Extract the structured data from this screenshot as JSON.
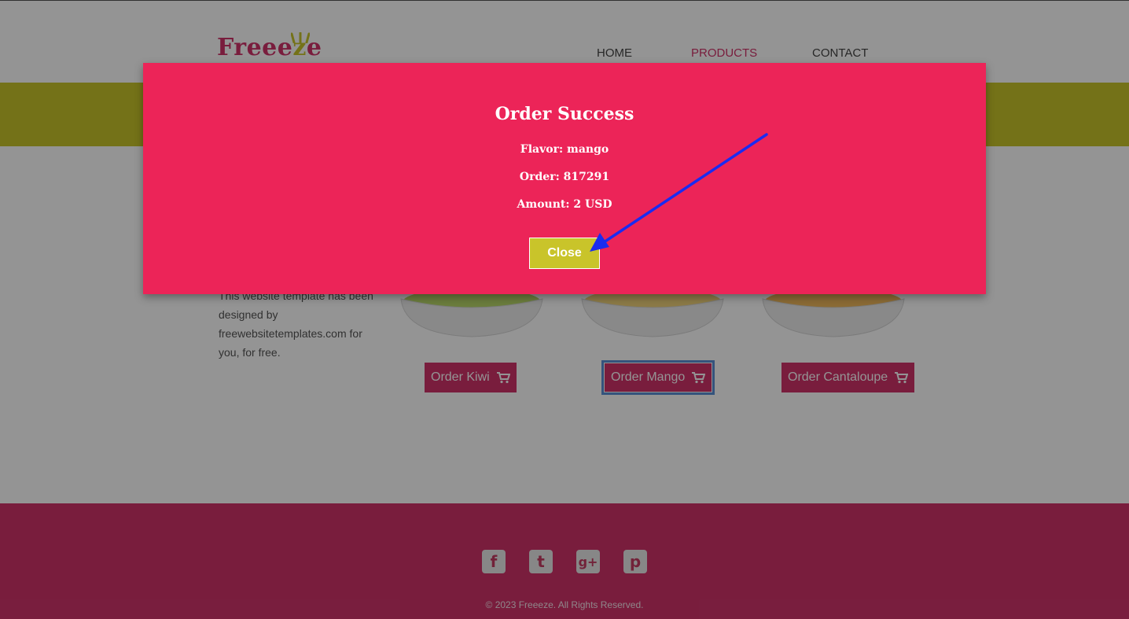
{
  "header": {
    "logo_text_a": "Freee",
    "logo_text_z": "z",
    "logo_text_e": "e",
    "nav": [
      {
        "label": "HOME"
      },
      {
        "label": "PRODUCTS"
      },
      {
        "label": "CONTACT"
      }
    ],
    "active_nav": "PRODUCTS"
  },
  "content": {
    "side_text": "This website template has been designed by freewebsitetemplates.com for you, for free.",
    "products": [
      {
        "button": "Order Kiwi",
        "fruit_color": "#b8d86a"
      },
      {
        "button": "Order Mango",
        "fruit_color": "#f1d27a"
      },
      {
        "button": "Order Cantaloupe",
        "fruit_color": "#f0b85c"
      }
    ]
  },
  "footer": {
    "social": [
      "facebook-icon",
      "twitter-icon",
      "google-plus-icon",
      "pinterest-icon"
    ],
    "social_glyphs": [
      "f",
      "t",
      "g+",
      "p"
    ],
    "copyright": "© 2023 Freeeze. All Rights Reserved."
  },
  "modal": {
    "title": "Order Success",
    "flavor": "Flavor: mango",
    "order": "Order: 817291",
    "amount": "Amount: 2 USD",
    "close_label": "Close"
  },
  "colors": {
    "brand_pink": "#d0336a",
    "modal_pink": "#ec2458",
    "accent_yellow": "#c9c42a",
    "arrow_blue": "#1a2cf0"
  }
}
